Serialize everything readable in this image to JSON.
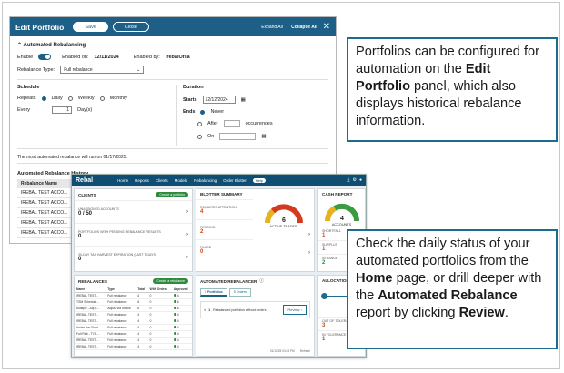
{
  "edit_portfolio": {
    "title": "Edit Portfolio",
    "save": "Save",
    "close": "Close",
    "expand_all": "Expand All",
    "collapse_all": "Collapse All",
    "section_title": "Automated Rebalancing",
    "enable_label": "Enable",
    "enabled_on_label": "Enabled on:",
    "enabled_on_value": "12/11/2024",
    "enabled_by_label": "Enabled by:",
    "enabled_by_value": "irebalOfsa",
    "rebalance_type_label": "Rebalance Type:",
    "rebalance_type_value": "Full rebalance",
    "schedule_label": "Schedule",
    "repeats_label": "Repeats",
    "repeat_options": [
      "Daily",
      "Weekly",
      "Monthly"
    ],
    "every_label": "Every",
    "every_value": "1",
    "every_unit": "Day(s)",
    "duration_label": "Duration",
    "starts_label": "Starts",
    "starts_value": "12/12/2024",
    "ends_label": "Ends",
    "ends_options": [
      "Never",
      "After",
      "On"
    ],
    "occurrences_label": "occurrences",
    "next_run_note": "The most automated rebalance will run on 01/17/2025.",
    "history_title": "Automated Rebalance History",
    "history_column": "Rebalance Name",
    "history_rows": [
      "IREBAL TEST ACCO...",
      "IREBAL TEST ACCO...",
      "IREBAL TEST ACCO...",
      "IREBAL TEST ACCO...",
      "IREBAL TEST ACCO..."
    ]
  },
  "callout_1": {
    "part1": "Portfolios can be configured for automation on the ",
    "bold1": "Edit Portfolio",
    "part2": " panel, which also displays historical rebalance information."
  },
  "callout_2": {
    "part1": "Check the daily status of your automated portfolios from the ",
    "bold1": "Home",
    "part2": " page, or drill deeper with the ",
    "bold2": "Automated Rebalance",
    "part3": " report by clicking ",
    "bold3": "Review",
    "part4": "."
  },
  "rebal": {
    "logo": "Rebal",
    "nav": [
      "Home",
      "Reports",
      "Clients",
      "Models",
      "Rebalancing",
      "Order Blotter"
    ],
    "help": "Help",
    "clients": {
      "title": "CLIENTS",
      "button": "Create a portfolio",
      "items": [
        {
          "label": "UNASSIGNED ACCOUNTS",
          "value": "0 / 50"
        },
        {
          "label": "PORTFOLIOS WITH PENDING REBALANCE RESULTS",
          "value": "0"
        },
        {
          "label": "30-DAY TAX HARVEST EXPIRATION (LAST 7 DAYS)",
          "value": "0"
        }
      ]
    },
    "blotter": {
      "title": "BLOTTER SUMMARY",
      "gauge_value": "6",
      "gauge_label": "ACTIVE TRADES",
      "items": [
        {
          "label": "REQUIRES ATTENTION",
          "value": "4"
        },
        {
          "label": "PENDING",
          "value": "2"
        },
        {
          "label": "FILLED",
          "value": "0"
        }
      ]
    },
    "cash": {
      "title": "CASH REPORT",
      "gauge_value": "4",
      "gauge_label": "ACCOUNTS",
      "items": [
        {
          "label": "SHORTFALL",
          "value": "1"
        },
        {
          "label": "SURPLUS",
          "value": "1"
        },
        {
          "label": "IN RANGE",
          "value": "2"
        }
      ]
    },
    "rebalances": {
      "title": "REBALANCES",
      "button": "Create a rebalance",
      "columns": [
        "Name",
        "Type",
        "Total",
        "With Orders",
        "Approved"
      ],
      "rows": [
        [
          "IREBAL TEST...",
          "Full rebalance",
          "4",
          "0",
          "4"
        ],
        [
          "TSM Schedule...",
          "Full rebalance",
          "6",
          "0",
          "6"
        ],
        [
          "Multiple - Adj E...",
          "Adjust via unflow",
          "6",
          "0",
          "6"
        ],
        [
          "IREBAL TEST...",
          "Full rebalance",
          "4",
          "0",
          "4"
        ],
        [
          "IREBAL TEST...",
          "Full rebalance",
          "4",
          "0",
          "4"
        ],
        [
          "Andre the Giant...",
          "Full rebalance",
          "4",
          "0",
          "4"
        ],
        [
          "Full Reb - TY1...",
          "Full rebalance",
          "4",
          "0",
          "4"
        ],
        [
          "IREBAL TEST...",
          "Full rebalance",
          "4",
          "0",
          "4"
        ],
        [
          "IREBAL TEST...",
          "Full rebalance",
          "4",
          "0",
          "4"
        ]
      ]
    },
    "auto_rebalancer": {
      "title": "AUTOMATED REBALANCER",
      "tabs": [
        "1 Portfolios",
        "5 Orders"
      ],
      "row_count": "1",
      "row_text": "Rebalanced portfolios without orders",
      "review": "Review",
      "footer_date": "01/10/25 03:45 PM",
      "footer_refresh": "Refresh"
    },
    "allocation": {
      "title": "ALLOCATION R",
      "items": [
        {
          "label": "OUT OF TOLERANCE",
          "value": "3"
        },
        {
          "label": "IN TOLERANCE",
          "value": "1"
        }
      ]
    }
  }
}
